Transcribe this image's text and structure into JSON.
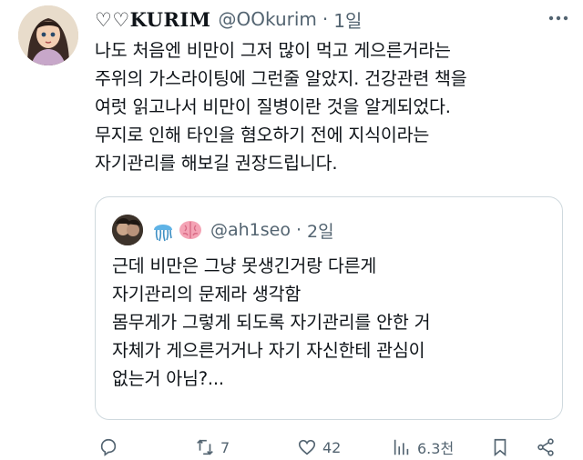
{
  "tweet": {
    "author": {
      "display_name": "♡♡KURIM",
      "handle": "@OOkurim",
      "time": "1일"
    },
    "separator": "·",
    "text": "나도 처음엔 비만이 그저 많이 먹고 게으른거라는\n주위의 가스라이팅에 그런줄 알았지. 건강관련 책을\n여럿 읽고나서 비만이 질병이란 것을 알게되었다.\n무지로 인해 타인을 혐오하기 전에 지식이라는\n자기관리를 해보길 권장드립니다."
  },
  "quoted_tweet": {
    "handle": "@ah1seo",
    "time": "2일",
    "emojis": [
      "jellyfish-icon",
      "brain-icon"
    ],
    "text": "근데 비만은 그냥 못생긴거랑 다른게\n자기관리의 문제라 생각함\n몸무게가 그렇게 되도록 자기관리를 안한 거\n자체가 게으른거거나 자기 자신한테 관심이\n없는거 아님?..."
  },
  "actions": {
    "reply_count": "",
    "retweet_count": "7",
    "like_count": "42",
    "views_count": "6.3천"
  },
  "colors": {
    "text": "#0f1419",
    "secondary": "#536471",
    "border": "#cfd9de"
  }
}
